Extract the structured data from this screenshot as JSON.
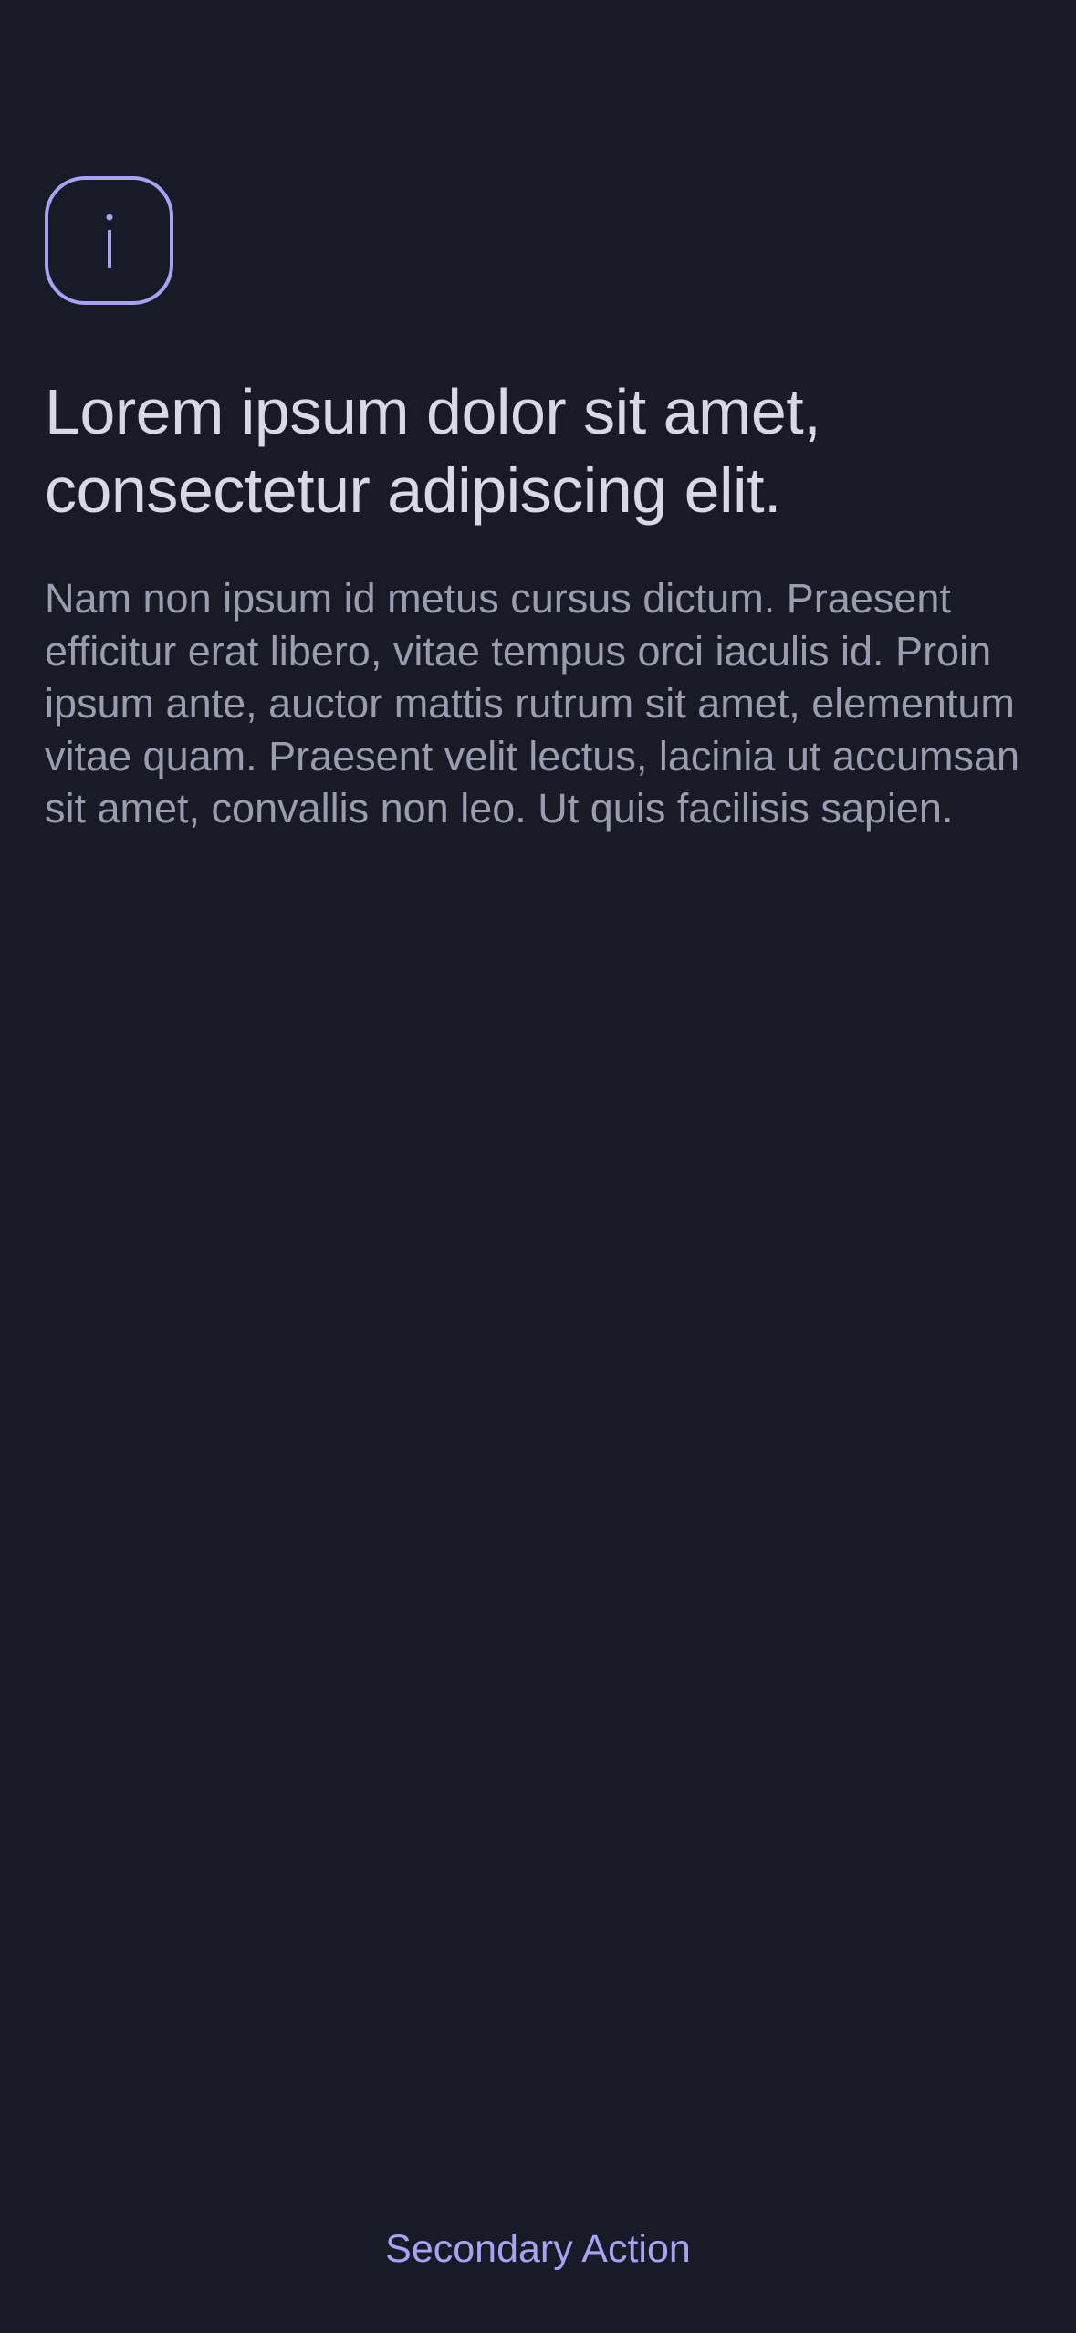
{
  "header": {
    "icon": "info-icon"
  },
  "content": {
    "title": "Lorem ipsum dolor sit amet, consectetur adipiscing elit.",
    "body": "Nam non ipsum id metus cursus dictum. Praesent efficitur erat libero, vitae tempus orci iaculis id. Proin ipsum ante, auctor mattis rutrum sit amet, elementum vitae quam. Praesent velit lectus, lacinia ut accumsan sit amet, convallis non leo. Ut quis facilisis sapien."
  },
  "actions": {
    "secondary_label": "Secondary Action"
  },
  "colors": {
    "background": "#181b25",
    "accent": "#a6a2f5",
    "title": "#d7d9e6",
    "body": "#9a9db0"
  }
}
